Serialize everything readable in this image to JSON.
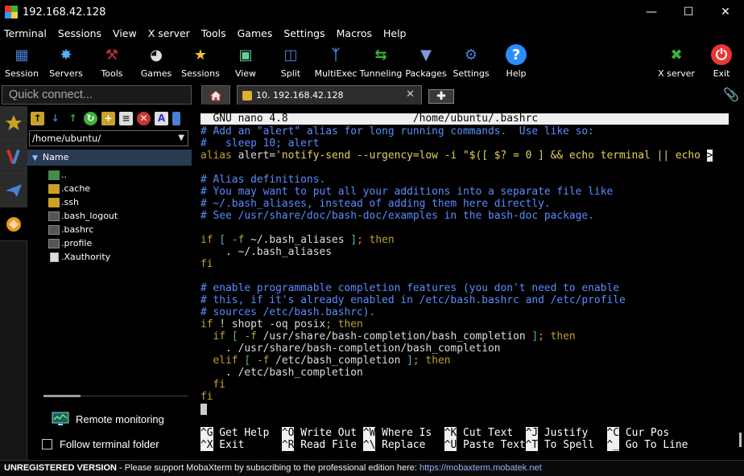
{
  "window": {
    "title": "192.168.42.128"
  },
  "menu": [
    "Terminal",
    "Sessions",
    "View",
    "X server",
    "Tools",
    "Games",
    "Settings",
    "Macros",
    "Help"
  ],
  "toolbar": {
    "left": [
      {
        "label": "Session",
        "icon": "session-icon"
      },
      {
        "label": "Servers",
        "icon": "servers-icon"
      },
      {
        "label": "Tools",
        "icon": "tools-icon"
      },
      {
        "label": "Games",
        "icon": "games-icon"
      },
      {
        "label": "Sessions",
        "icon": "sessions-star-icon"
      },
      {
        "label": "View",
        "icon": "view-icon"
      },
      {
        "label": "Split",
        "icon": "split-icon"
      },
      {
        "label": "MultiExec",
        "icon": "multiexec-icon"
      },
      {
        "label": "Tunneling",
        "icon": "tunneling-icon"
      },
      {
        "label": "Packages",
        "icon": "packages-icon"
      },
      {
        "label": "Settings",
        "icon": "settings-icon"
      },
      {
        "label": "Help",
        "icon": "help-icon"
      }
    ],
    "right": [
      {
        "label": "X server",
        "icon": "xserver-icon"
      },
      {
        "label": "Exit",
        "icon": "exit-icon"
      }
    ]
  },
  "quick_connect": {
    "placeholder": "Quick connect..."
  },
  "tabs": {
    "active_label": "10. 192.168.42.128"
  },
  "sidebar": {
    "path": "/home/ubuntu/",
    "column": "Name",
    "files": [
      {
        "name": "..",
        "kind": "up"
      },
      {
        "name": ".cache",
        "kind": "folder"
      },
      {
        "name": ".ssh",
        "kind": "folder"
      },
      {
        "name": ".bash_logout",
        "kind": "file"
      },
      {
        "name": ".bashrc",
        "kind": "file"
      },
      {
        "name": ".profile",
        "kind": "file"
      },
      {
        "name": ".Xauthority",
        "kind": "doc"
      }
    ],
    "remote_monitoring": "Remote monitoring",
    "follow_folder": "Follow terminal folder"
  },
  "terminal": {
    "nano_header": "  GNU nano 4.8                    /home/ubuntu/.bashrc",
    "lines": [
      {
        "parts": [
          [
            "c-cmt",
            "# Add an \"alert\" alias for long running commands.  Use like so:"
          ]
        ]
      },
      {
        "parts": [
          [
            "c-cmt",
            "#   sleep 10; alert"
          ]
        ]
      },
      {
        "parts": [
          [
            "c-kw",
            "alias "
          ],
          [
            "c-wh",
            "alert="
          ],
          [
            "c-str",
            "'notify-send --urgency=low -i \"$([ $? = 0 ] && echo terminal || echo "
          ],
          [
            "kk",
            ">"
          ]
        ]
      },
      {
        "parts": [
          [
            "c-wh",
            ""
          ]
        ]
      },
      {
        "parts": [
          [
            "c-cmt",
            "# Alias definitions."
          ]
        ]
      },
      {
        "parts": [
          [
            "c-cmt",
            "# You may want to put all your additions into a separate file like"
          ]
        ]
      },
      {
        "parts": [
          [
            "c-cmt",
            "# ~/.bash_aliases, instead of adding them here directly."
          ]
        ]
      },
      {
        "parts": [
          [
            "c-cmt",
            "# See /usr/share/doc/bash-doc/examples in the bash-doc package."
          ]
        ]
      },
      {
        "parts": [
          [
            "c-wh",
            ""
          ]
        ]
      },
      {
        "parts": [
          [
            "c-kw",
            "if "
          ],
          [
            "c-teal",
            "[ "
          ],
          [
            "c-kw",
            "-f "
          ],
          [
            "c-wh",
            "~/.bash_aliases "
          ],
          [
            "c-teal",
            "]"
          ],
          [
            "c-kw",
            "; then"
          ]
        ]
      },
      {
        "parts": [
          [
            "c-wh",
            "    . ~/.bash_aliases"
          ]
        ]
      },
      {
        "parts": [
          [
            "c-kw",
            "fi"
          ]
        ]
      },
      {
        "parts": [
          [
            "c-wh",
            ""
          ]
        ]
      },
      {
        "parts": [
          [
            "c-cmt",
            "# enable programmable completion features (you don't need to enable"
          ]
        ]
      },
      {
        "parts": [
          [
            "c-cmt",
            "# this, if it's already enabled in /etc/bash.bashrc and /etc/profile"
          ]
        ]
      },
      {
        "parts": [
          [
            "c-cmt",
            "# sources /etc/bash.bashrc)."
          ]
        ]
      },
      {
        "parts": [
          [
            "c-kw",
            "if "
          ],
          [
            "c-wh",
            "! shopt -oq posix"
          ],
          [
            "c-kw",
            "; then"
          ]
        ]
      },
      {
        "parts": [
          [
            "c-kw",
            "  if "
          ],
          [
            "c-teal",
            "[ "
          ],
          [
            "c-kw",
            "-f "
          ],
          [
            "c-wh",
            "/usr/share/bash-completion/bash_completion "
          ],
          [
            "c-teal",
            "]"
          ],
          [
            "c-kw",
            "; then"
          ]
        ]
      },
      {
        "parts": [
          [
            "c-wh",
            "    . /usr/share/bash-completion/bash_completion"
          ]
        ]
      },
      {
        "parts": [
          [
            "c-kw",
            "  elif "
          ],
          [
            "c-teal",
            "[ "
          ],
          [
            "c-kw",
            "-f "
          ],
          [
            "c-wh",
            "/etc/bash_completion "
          ],
          [
            "c-teal",
            "]"
          ],
          [
            "c-kw",
            "; then"
          ]
        ]
      },
      {
        "parts": [
          [
            "c-wh",
            "    . /etc/bash_completion"
          ]
        ]
      },
      {
        "parts": [
          [
            "c-kw",
            "  fi"
          ]
        ]
      },
      {
        "parts": [
          [
            "c-kw",
            "fi"
          ]
        ]
      }
    ],
    "shortcuts_row1": [
      [
        "^G",
        " Get Help  "
      ],
      [
        "^O",
        " Write Out "
      ],
      [
        "^W",
        " Where Is  "
      ],
      [
        "^K",
        " Cut Text  "
      ],
      [
        "^J",
        " Justify   "
      ],
      [
        "^C",
        " Cur Pos"
      ]
    ],
    "shortcuts_row2": [
      [
        "^X",
        " Exit      "
      ],
      [
        "^R",
        " Read File "
      ],
      [
        "^\\",
        " Replace   "
      ],
      [
        "^U",
        " Paste Text"
      ],
      [
        "^T",
        " To Spell  "
      ],
      [
        "^_",
        " Go To Line"
      ]
    ]
  },
  "status": {
    "unregistered": "UNREGISTERED VERSION",
    "message": "  -  Please support MobaXterm by subscribing to the professional edition here:  ",
    "link": "https://mobaxterm.mobatek.net"
  },
  "colors": {
    "accent": "#2a3a52",
    "link": "#8fb6ff"
  }
}
